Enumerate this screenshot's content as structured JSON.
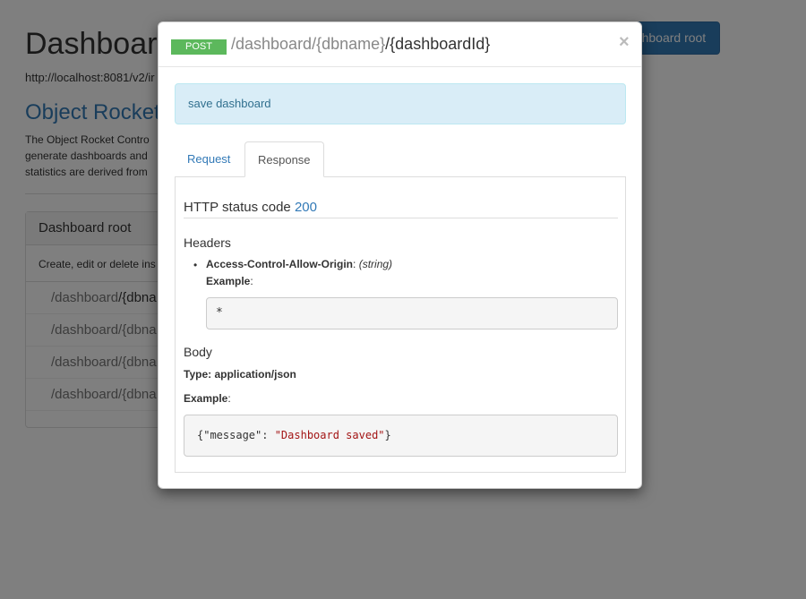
{
  "background": {
    "title": "Dashboard",
    "url": "http://localhost:8081/v2/ir",
    "top_button": "ashboard root",
    "section_title": "Object Rocket",
    "description": [
      "The Object Rocket Contro",
      "generate dashboards and",
      "statistics are derived from"
    ],
    "panel": {
      "heading": "Dashboard root",
      "body": "Create, edit or delete ins",
      "endpoints": [
        {
          "muted": "/dashboard",
          "dark": "/{dbna"
        },
        {
          "muted": "/dashboard/{dbna",
          "dark": ""
        },
        {
          "muted": "/dashboard/{dbna",
          "dark": ""
        },
        {
          "muted": "/dashboard/{dbna",
          "dark": ""
        }
      ]
    }
  },
  "modal": {
    "method": "POST",
    "path_muted": "/dashboard/{dbname}",
    "path_dark": "/{dashboardId}",
    "close_glyph": "×",
    "description": "save dashboard",
    "tabs": {
      "request": "Request",
      "response": "Response"
    },
    "response": {
      "status_label": "HTTP status code",
      "status_code": "200",
      "headers_title": "Headers",
      "header_name": "Access-Control-Allow-Origin",
      "header_sep": ":",
      "header_type": "(string)",
      "example_label": "Example",
      "header_example": "*",
      "body_title": "Body",
      "type_line": "Type: application/json",
      "body_example_key": "{\"message\": ",
      "body_example_value": "\"Dashboard saved\"",
      "body_example_end": "}"
    }
  },
  "colors": {
    "accent": "#337ab7",
    "method_post": "#5cb85c",
    "alert_bg": "#d9edf7"
  }
}
